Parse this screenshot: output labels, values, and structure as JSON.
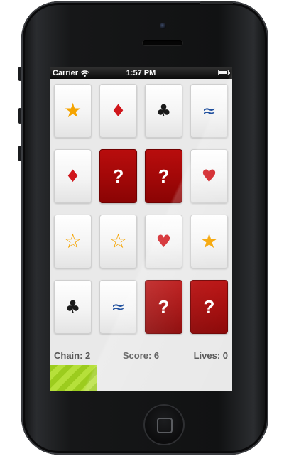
{
  "status_bar": {
    "carrier": "Carrier",
    "time": "1:57 PM",
    "wifi_icon": "wifi-icon",
    "battery_icon": "battery-icon"
  },
  "board": {
    "rows": 4,
    "columns": 4,
    "cards": [
      {
        "state": "face-up",
        "symbol": "★",
        "name": "filled-star",
        "color": "#f5a400"
      },
      {
        "state": "face-up",
        "symbol": "♦",
        "name": "diamond",
        "color": "#d0161b"
      },
      {
        "state": "face-up",
        "symbol": "♣",
        "name": "club",
        "color": "#1a1a1a"
      },
      {
        "state": "face-up",
        "symbol": "≈",
        "name": "waves",
        "color": "#1f4f9e"
      },
      {
        "state": "face-up",
        "symbol": "♦",
        "name": "diamond",
        "color": "#d0161b"
      },
      {
        "state": "face-down",
        "symbol": "?",
        "name": "hidden",
        "color": "#ffffff"
      },
      {
        "state": "face-down",
        "symbol": "?",
        "name": "hidden",
        "color": "#ffffff"
      },
      {
        "state": "face-up",
        "symbol": "♥",
        "name": "heart",
        "color": "#d0161b"
      },
      {
        "state": "face-up",
        "symbol": "☆",
        "name": "outline-star",
        "color": "#f5a400"
      },
      {
        "state": "face-up",
        "symbol": "☆",
        "name": "outline-star",
        "color": "#f5a400"
      },
      {
        "state": "face-up",
        "symbol": "♥",
        "name": "heart",
        "color": "#d0161b"
      },
      {
        "state": "face-up",
        "symbol": "★",
        "name": "filled-star",
        "color": "#f5a400"
      },
      {
        "state": "face-up",
        "symbol": "♣",
        "name": "club",
        "color": "#1a1a1a"
      },
      {
        "state": "face-up",
        "symbol": "≈",
        "name": "waves",
        "color": "#1f4f9e"
      },
      {
        "state": "face-down",
        "symbol": "?",
        "name": "hidden",
        "color": "#ffffff"
      },
      {
        "state": "face-down",
        "symbol": "?",
        "name": "hidden",
        "color": "#ffffff"
      }
    ]
  },
  "hud": {
    "chain": "Chain: 2",
    "score": "Score: 6",
    "lives": "Lives: 0"
  },
  "progress": {
    "fraction": 0.26,
    "color": "#9ccc1e"
  }
}
